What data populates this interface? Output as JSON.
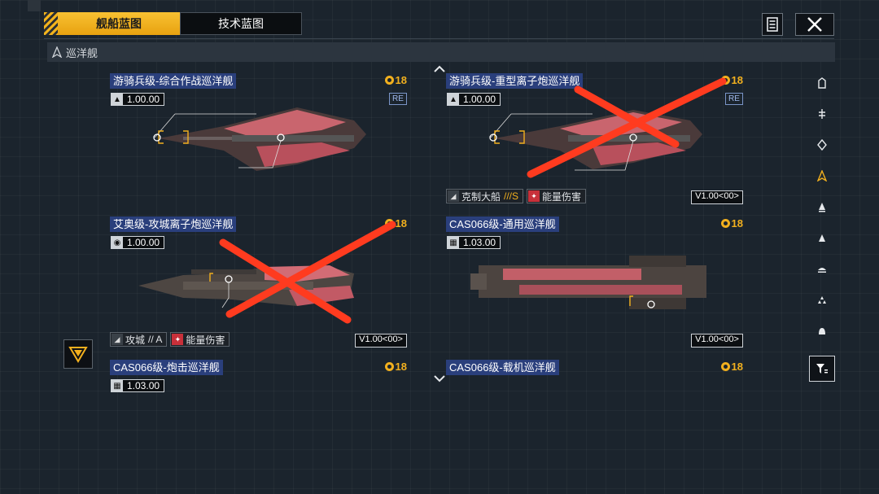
{
  "tabs": [
    {
      "label": "舰船蓝图",
      "active": true
    },
    {
      "label": "技术蓝图",
      "active": false
    }
  ],
  "category": {
    "label": "巡洋舰",
    "icon": "cruiser-icon"
  },
  "colors": {
    "accent": "#f2b01e",
    "cross": "#ff3b1f",
    "name_bg": "#2a3f7c"
  },
  "cards": [
    {
      "name": "游骑兵级-综合作战巡洋舰",
      "cost": "18",
      "version": "1.00.00",
      "re": "RE",
      "badge": "",
      "tags": [],
      "crossed": false
    },
    {
      "name": "游骑兵级-重型离子炮巡洋舰",
      "cost": "18",
      "version": "1.00.00",
      "re": "RE",
      "badge": "V1.00<00>",
      "tags": [
        {
          "label": "克制大船",
          "grade": "///S"
        },
        {
          "label": "能量伤害",
          "grade": ""
        }
      ],
      "crossed": true
    },
    {
      "name": "艾奥级-攻城离子炮巡洋舰",
      "cost": "18",
      "version": "1.00.00",
      "re": "",
      "badge": "V1.00<00>",
      "tags": [
        {
          "label": "攻城",
          "grade": "// A"
        },
        {
          "label": "能量伤害",
          "grade": ""
        }
      ],
      "crossed": true
    },
    {
      "name": "CAS066级-通用巡洋舰",
      "cost": "18",
      "version": "1.03.00",
      "re": "",
      "badge": "V1.00<00>",
      "tags": [],
      "crossed": false
    },
    {
      "name": "CAS066级-炮击巡洋舰",
      "cost": "18",
      "version": "1.03.00",
      "re": "",
      "badge": "",
      "tags": [],
      "crossed": false
    },
    {
      "name": "CAS066级-载机巡洋舰",
      "cost": "18",
      "version": "",
      "re": "",
      "badge": "",
      "tags": [],
      "crossed": false
    }
  ],
  "sidebar_icons": [
    "fortress-icon",
    "carrier-icon",
    "battleship-icon",
    "cruiser-icon",
    "destroyer-icon",
    "frigate-icon",
    "corvette-icon",
    "fighter-icon",
    "utility-icon"
  ],
  "sidebar_active": 3
}
